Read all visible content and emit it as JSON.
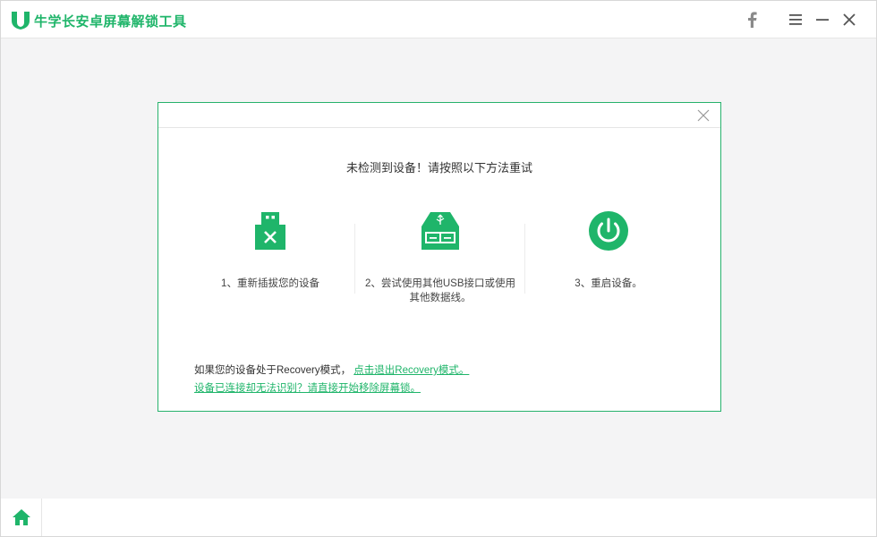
{
  "app": {
    "title": "牛学长安卓屏幕解锁工具",
    "accent_color": "#1fb56a"
  },
  "titlebar": {
    "icons": [
      "facebook-icon",
      "menu-icon",
      "minimize-icon",
      "close-icon"
    ]
  },
  "dialog": {
    "heading": "未检测到设备！请按照以下方法重试",
    "steps": [
      {
        "icon": "usb-unplug-icon",
        "label": "1、重新插拔您的设备"
      },
      {
        "icon": "usb-port-icon",
        "label": "2、尝试使用其他USB接口或使用其他数据线。"
      },
      {
        "icon": "power-icon",
        "label": "3、重启设备。"
      }
    ],
    "recovery_prefix": "如果您的设备处于Recovery模式，",
    "recovery_link": "点击退出Recovery模式。",
    "unrecognized_link": "设备已连接却无法识别？请直接开始移除屏幕锁。"
  },
  "bottombar": {
    "home_icon": "home-icon"
  }
}
